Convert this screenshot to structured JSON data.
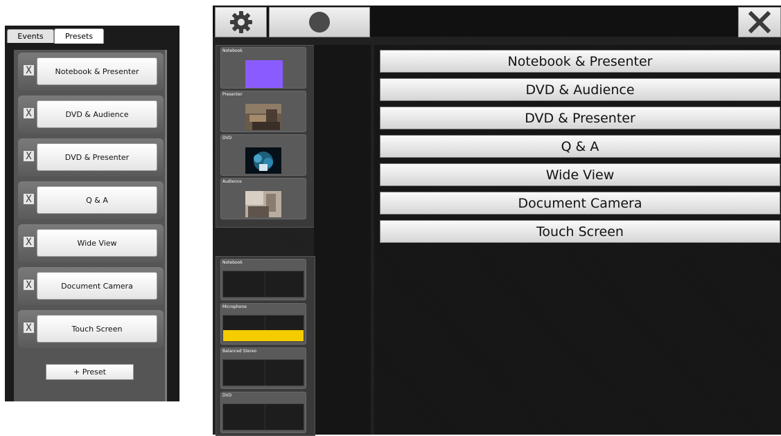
{
  "left_panel": {
    "tabs": [
      {
        "label": "Events"
      },
      {
        "label": "Presets"
      }
    ],
    "presets": [
      {
        "label": "Notebook & Presenter",
        "remove": "X"
      },
      {
        "label": "DVD & Audience",
        "remove": "X"
      },
      {
        "label": "DVD & Presenter",
        "remove": "X"
      },
      {
        "label": "Q & A",
        "remove": "X"
      },
      {
        "label": "Wide View",
        "remove": "X"
      },
      {
        "label": "Document Camera",
        "remove": "X"
      },
      {
        "label": "Touch Screen",
        "remove": "X"
      }
    ],
    "add_preset_label": "+ Preset"
  },
  "toolbar": {
    "settings_icon": "gear-icon",
    "record_icon": "record-circle-icon",
    "close_icon": "close-x-icon",
    "record_color": "#4a4a4a"
  },
  "video_sources": [
    {
      "label": "Notebook",
      "thumb": "solid",
      "color": "#8a5cff"
    },
    {
      "label": "Presenter",
      "thumb": "photo-room"
    },
    {
      "label": "DVD",
      "thumb": "photo-dvd"
    },
    {
      "label": "Audience",
      "thumb": "photo-audience"
    }
  ],
  "audio_sources": [
    {
      "label": "Notebook",
      "level": 0
    },
    {
      "label": "Microphone",
      "level": 0.4
    },
    {
      "label": "Balanced Stereo",
      "level": 0
    },
    {
      "label": "DVD",
      "level": 0
    }
  ],
  "presets": [
    {
      "label": "Notebook & Presenter"
    },
    {
      "label": "DVD & Audience"
    },
    {
      "label": "DVD & Presenter"
    },
    {
      "label": "Q & A"
    },
    {
      "label": "Wide View"
    },
    {
      "label": "Document Camera"
    },
    {
      "label": "Touch Screen"
    }
  ],
  "colors": {
    "level_meter": "#f3cd00",
    "panel_bg": "#1f1f1f"
  }
}
